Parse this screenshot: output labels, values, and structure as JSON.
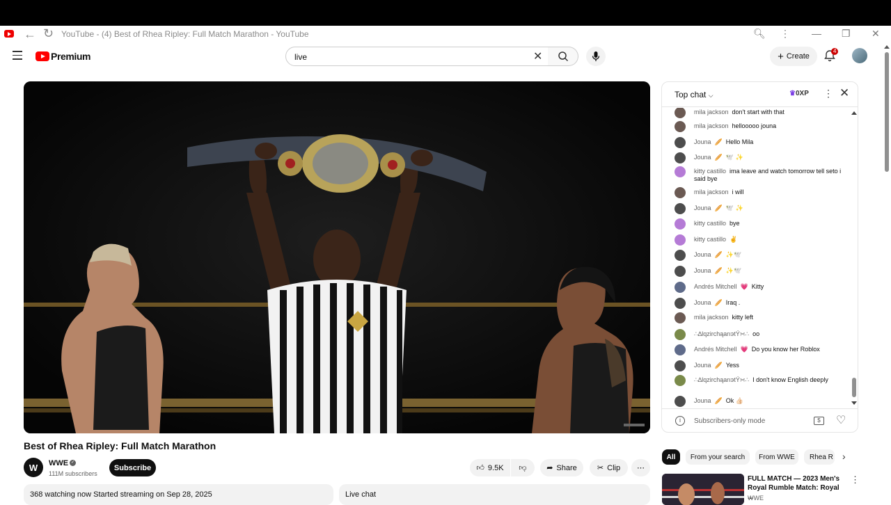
{
  "browser": {
    "tab_title": "YouTube - (4) Best of Rhea Ripley: Full Match Marathon - YouTube"
  },
  "header": {
    "logo_text": "Premium",
    "search_value": "live",
    "create_label": "Create",
    "notification_count": "4"
  },
  "video": {
    "title": "Best of Rhea Ripley: Full Match Marathon",
    "watermark": "NXT"
  },
  "channel": {
    "avatar_text": "W",
    "name": "WWE",
    "subscribers": "111M subscribers",
    "subscribe_label": "Subscribe"
  },
  "actions": {
    "likes": "9.5K",
    "share": "Share",
    "clip": "Clip"
  },
  "description": {
    "text": "368 watching now  Started streaming on Sep 28, 2025"
  },
  "live_chat_box": {
    "label": "Live chat"
  },
  "chat": {
    "header": "Top chat",
    "xp": "0XP",
    "footer_label": "Subscribers-only mode",
    "messages": [
      {
        "author": "mila jackson",
        "text": "don't start with that",
        "color": "#6b5a53"
      },
      {
        "author": "mila jackson",
        "text": "hellooooo jouna",
        "color": "#6b5a53"
      },
      {
        "author": "Jouna",
        "badge": "🥖",
        "text": "Hello Mila",
        "color": "#4d4d4d"
      },
      {
        "author": "Jouna",
        "badge": "🥖",
        "text": "🕊️ ✨",
        "color": "#4d4d4d"
      },
      {
        "author": "kitty castillo",
        "text": "ima leave and watch tomorrow tell seto i said bye",
        "color": "#b57bd6"
      },
      {
        "author": "mila jackson",
        "text": "i will",
        "color": "#6b5a53"
      },
      {
        "author": "Jouna",
        "badge": "🥖",
        "text": "🕊️ ✨",
        "color": "#4d4d4d"
      },
      {
        "author": "kitty castillo",
        "text": "bye",
        "color": "#b57bd6"
      },
      {
        "author": "kitty castillo",
        "text": "✌️",
        "color": "#b57bd6"
      },
      {
        "author": "Jouna",
        "badge": "🥖",
        "text": "✨🕊️",
        "color": "#4d4d4d"
      },
      {
        "author": "Jouna",
        "badge": "🥖",
        "text": "✨🕊️",
        "color": "#4d4d4d"
      },
      {
        "author": "Andrés Mitchell",
        "badge": "💗",
        "text": "Kitty",
        "color": "#5f6b8a"
      },
      {
        "author": "Jouna",
        "badge": "🥖",
        "text": "Iraq .",
        "color": "#4d4d4d"
      },
      {
        "author": "mila jackson",
        "text": "kitty left",
        "color": "#6b5a53"
      },
      {
        "author": "∴∆lqzirchąarıэtÝ∺∴",
        "text": "oo",
        "color": "#7a8a4a"
      },
      {
        "author": "Andrés Mitchell",
        "badge": "💗",
        "text": "Do you know her Roblox",
        "color": "#5f6b8a"
      },
      {
        "author": "Jouna",
        "badge": "🥖",
        "text": "Yess",
        "color": "#4d4d4d"
      },
      {
        "author": "∴∆lqzirchąarıэtÝ∺∴",
        "text": "I don't know English deeply",
        "color": "#7a8a4a"
      },
      {
        "author": "Jouna",
        "badge": "🥖",
        "text": "Ok 👍🏻",
        "color": "#4d4d4d"
      }
    ]
  },
  "chips": [
    "All",
    "From your search",
    "From WWE",
    "Rhea R"
  ],
  "recommendation": {
    "title": "FULL MATCH — 2023 Men's Royal Rumble Match: Royal ...",
    "channel": "WWE"
  }
}
